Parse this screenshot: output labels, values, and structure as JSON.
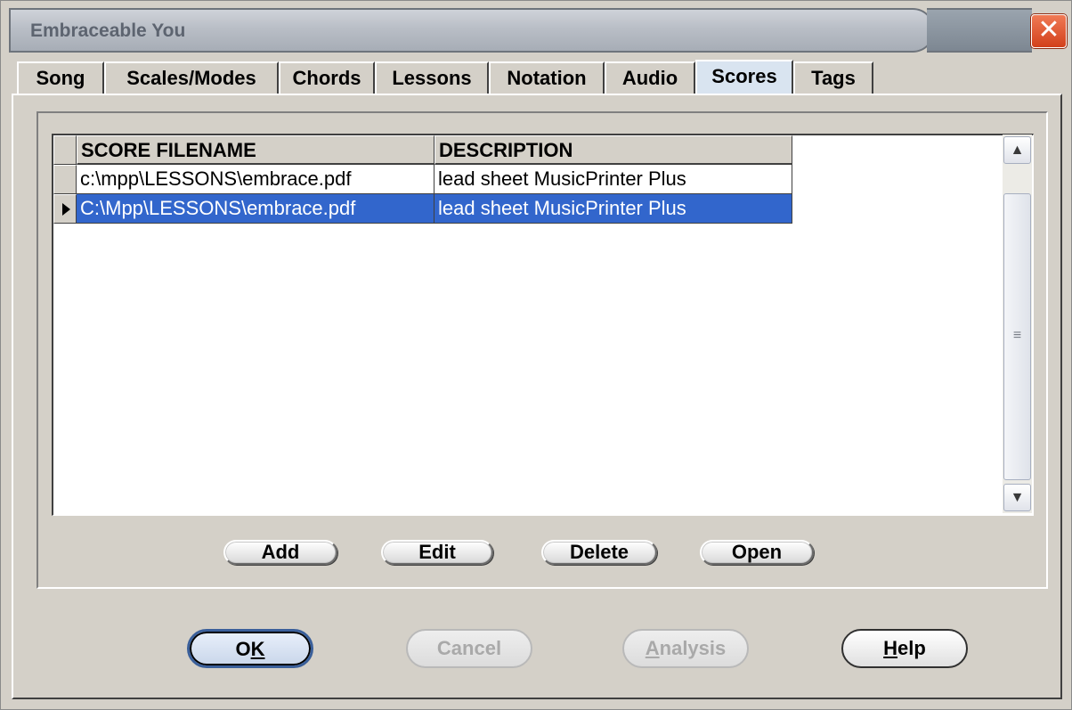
{
  "window": {
    "title": "Embraceable You",
    "close_glyph": "✕"
  },
  "tabs": [
    {
      "label": "Song",
      "active": false
    },
    {
      "label": "Scales/Modes",
      "active": false
    },
    {
      "label": "Chords",
      "active": false
    },
    {
      "label": "Lessons",
      "active": false
    },
    {
      "label": "Notation",
      "active": false
    },
    {
      "label": "Audio",
      "active": false
    },
    {
      "label": "Scores",
      "active": true
    },
    {
      "label": "Tags",
      "active": false
    }
  ],
  "grid": {
    "columns": [
      "SCORE FILENAME",
      "DESCRIPTION"
    ],
    "rows": [
      {
        "filename": "c:\\mpp\\LESSONS\\embrace.pdf",
        "description": "lead sheet MusicPrinter Plus",
        "selected": false
      },
      {
        "filename": "C:\\Mpp\\LESSONS\\embrace.pdf",
        "description": "lead sheet MusicPrinter Plus",
        "selected": true
      }
    ]
  },
  "grid_actions": {
    "add": "Add",
    "edit": "Edit",
    "delete": "Delete",
    "open": "Open"
  },
  "dialog_buttons": {
    "ok": {
      "before": "O",
      "underlined": "K",
      "after": ""
    },
    "cancel": "Cancel",
    "analysis": {
      "before": "",
      "underlined": "A",
      "after": "nalysis"
    },
    "help": {
      "before": "",
      "underlined": "H",
      "after": "elp"
    }
  },
  "colors": {
    "selection": "#3266cc",
    "close_button": "#d2401b",
    "active_tab": "#d9e4f0"
  }
}
